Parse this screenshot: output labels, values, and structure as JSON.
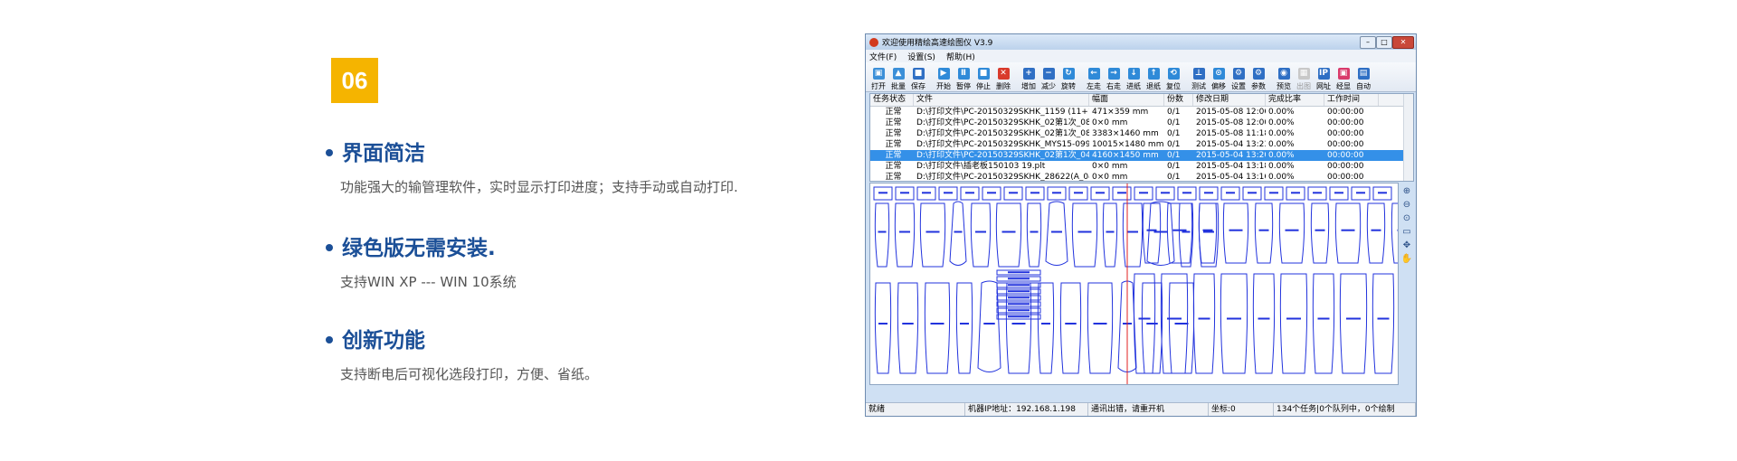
{
  "badge": "06",
  "features": [
    {
      "title": "界面简洁",
      "desc": "功能强大的输管理软件，实时显示打印进度；支持手动或自动打印."
    },
    {
      "title": "绿色版无需安装.",
      "desc": "支持WIN XP ---  WIN 10系统"
    },
    {
      "title": "创新功能",
      "desc": "支持断电后可视化选段打印，方便、省纸。"
    }
  ],
  "window": {
    "title": "欢迎使用精绘高速绘图仪 V3.9",
    "controls": {
      "min": "–",
      "max": "□",
      "close": "✕"
    },
    "menu": [
      "文件(F)",
      "设置(S)",
      "帮助(H)"
    ],
    "toolbar": [
      {
        "label": "打开",
        "icon": "folder-icon",
        "color": "#3b8fd8",
        "glyph": "▣"
      },
      {
        "label": "批量",
        "icon": "batch-icon",
        "color": "#3b8fd8",
        "glyph": "▲"
      },
      {
        "label": "保存",
        "icon": "save-icon",
        "color": "#2f6fc4",
        "glyph": "■"
      },
      {
        "label": "开始",
        "icon": "play-icon",
        "color": "#2f8ad8",
        "glyph": "▶"
      },
      {
        "label": "暂停",
        "icon": "pause-icon",
        "color": "#2f8ad8",
        "glyph": "Ⅱ"
      },
      {
        "label": "停止",
        "icon": "stop-icon",
        "color": "#2f8ad8",
        "glyph": "■"
      },
      {
        "label": "删除",
        "icon": "delete-icon",
        "color": "#d93a2b",
        "glyph": "✕"
      },
      {
        "label": "增加",
        "icon": "plus-icon",
        "color": "#2f6fc4",
        "glyph": "+"
      },
      {
        "label": "减少",
        "icon": "minus-icon",
        "color": "#2f6fc4",
        "glyph": "−"
      },
      {
        "label": "旋转",
        "icon": "rotate-icon",
        "color": "#2f8ad8",
        "glyph": "↻"
      },
      {
        "label": "左走",
        "icon": "arrow-left-icon",
        "color": "#2f8ad8",
        "glyph": "←"
      },
      {
        "label": "右走",
        "icon": "arrow-right-icon",
        "color": "#2f8ad8",
        "glyph": "→"
      },
      {
        "label": "进纸",
        "icon": "arrow-down-icon",
        "color": "#2f8ad8",
        "glyph": "↓"
      },
      {
        "label": "退纸",
        "icon": "arrow-up-icon",
        "color": "#2f8ad8",
        "glyph": "↑"
      },
      {
        "label": "复位",
        "icon": "reset-icon",
        "color": "#2f8ad8",
        "glyph": "⟲"
      },
      {
        "label": "测试",
        "icon": "test-icon",
        "color": "#2f6fc4",
        "glyph": "⊥"
      },
      {
        "label": "偏移",
        "icon": "offset-icon",
        "color": "#2f8ad8",
        "glyph": "⊙"
      },
      {
        "label": "设置",
        "icon": "settings-icon",
        "color": "#2f6fc4",
        "glyph": "⚙"
      },
      {
        "label": "参数",
        "icon": "params-icon",
        "color": "#2f6fc4",
        "glyph": "⚙"
      },
      {
        "label": "预览",
        "icon": "preview-icon",
        "color": "#2f6fc4",
        "glyph": "◉"
      },
      {
        "label": "出图",
        "icon": "output-icon",
        "color": "#999999",
        "glyph": "▦",
        "disabled": true
      },
      {
        "label": "网址",
        "icon": "ip-icon",
        "color": "#2f6fc4",
        "glyph": "IP"
      },
      {
        "label": "经显",
        "icon": "display-icon",
        "color": "#d93a6b",
        "glyph": "▣"
      },
      {
        "label": "自动",
        "icon": "auto-icon",
        "color": "#2f6fc4",
        "glyph": "▤"
      }
    ],
    "table": {
      "headers": [
        "任务状态",
        "文件",
        "幅面",
        "份数",
        "修改日期",
        "完成比率",
        "工作时间"
      ],
      "rows": [
        [
          "正常",
          "D:\\打印文件\\PC-20150329SKHK_1159  (11+13+15...",
          "471×359 mm",
          "0/1",
          "2015-05-08 12:06",
          "0.00%",
          "00:00:00"
        ],
        [
          "正常",
          "D:\\打印文件\\PC-20150329SKHK_02第1次_0812002...",
          "0×0 mm",
          "0/1",
          "2015-05-08 12:00",
          "0.00%",
          "00:00:00"
        ],
        [
          "正常",
          "D:\\打印文件\\PC-20150329SKHK_02第1次_0811185...",
          "3383×1460 mm",
          "0/1",
          "2015-05-08 11:18",
          "0.00%",
          "00:00:00"
        ],
        [
          "正常",
          "D:\\打印文件\\PC-20150329SKHK_MYS15-0998_041...",
          "10015×1480 mm",
          "0/1",
          "2015-05-04 13:23",
          "0.00%",
          "00:00:00"
        ],
        [
          "正常",
          "D:\\打印文件\\PC-20150329SKHK_02第1次_0413201...",
          "4160×1450 mm",
          "0/1",
          "2015-05-04 13:20",
          "0.00%",
          "00:00:00"
        ],
        [
          "正常",
          "D:\\打印文件\\插老板150103 19.plt",
          "0×0 mm",
          "0/1",
          "2015-05-04 13:18",
          "0.00%",
          "00:00:00"
        ],
        [
          "正常",
          "D:\\打印文件\\PC-20150329SKHK_28622(A_041313...",
          "0×0 mm",
          "0/1",
          "2015-05-04 13:16",
          "0.00%",
          "00:00:00"
        ]
      ],
      "selected_row": 4
    },
    "side_tools": [
      {
        "icon": "zoom-in-icon",
        "glyph": "⊕"
      },
      {
        "icon": "zoom-out-icon",
        "glyph": "⊖"
      },
      {
        "icon": "zoom-fit-icon",
        "glyph": "⊙"
      },
      {
        "icon": "zoom-window-icon",
        "glyph": "▭"
      },
      {
        "icon": "center-icon",
        "glyph": "✥"
      },
      {
        "icon": "pan-hand-icon",
        "glyph": "✋"
      }
    ],
    "status": [
      "就绪",
      "机器IP地址：192.168.1.198",
      "通讯出错，请重开机",
      "坐标:0",
      "134个任务|0个队列中，0个绘制"
    ],
    "colors": {
      "pattern_line": "#2233dd",
      "cursor_line": "#e02020",
      "accent": "#1b4f97",
      "badge": "#f5b400"
    }
  }
}
